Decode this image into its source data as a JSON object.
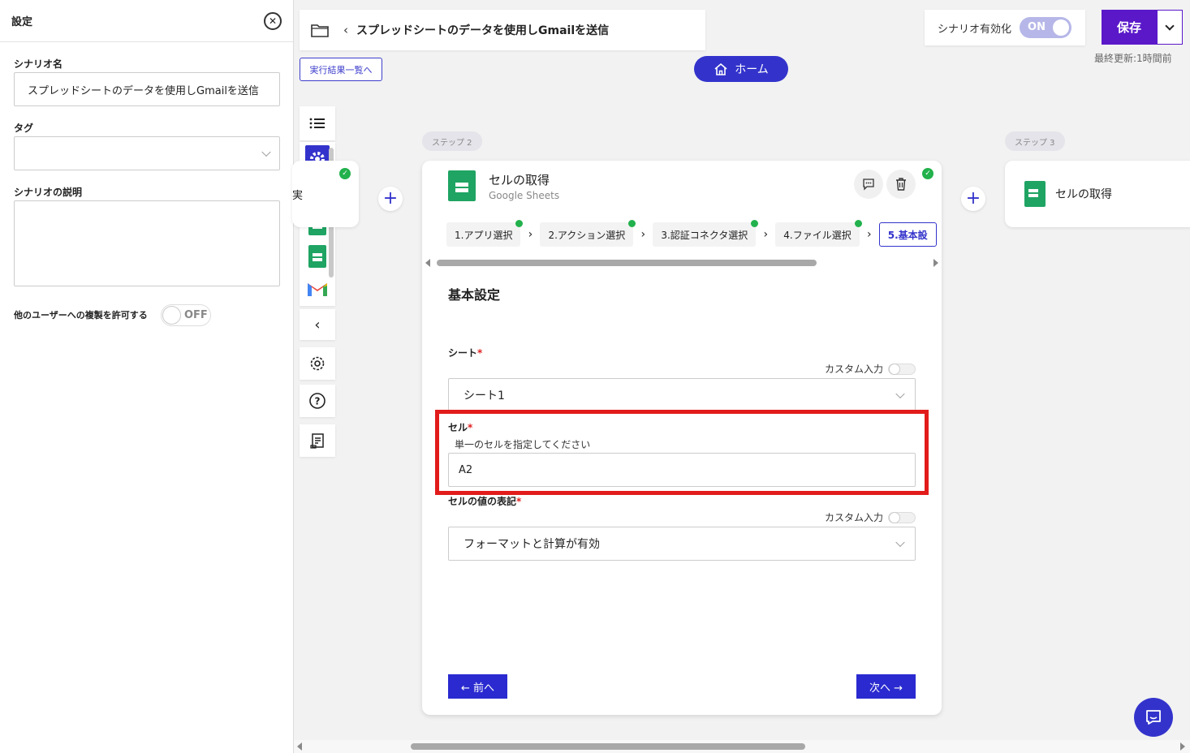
{
  "settings": {
    "title": "設定",
    "scenario_name_label": "シナリオ名",
    "scenario_name_value": "スプレッドシートのデータを使用しGmailを送信",
    "tag_label": "タグ",
    "tag_value": "",
    "description_label": "シナリオの説明",
    "description_value": "",
    "copy_label": "他のユーザーへの複製を許可する",
    "copy_toggle": "OFF"
  },
  "header": {
    "scenario_title": "スプレッドシートのデータを使用しGmailを送信",
    "results_button": "実行結果一覧へ",
    "home_button": "ホーム",
    "enable_label": "シナリオ有効化",
    "enable_toggle": "ON",
    "save_button": "保存",
    "last_updated": "最終更新:1時間前"
  },
  "canvas": {
    "prev_card_partial_text": "実",
    "step2_label": "ステップ 2",
    "step3_label": "ステップ 3",
    "step3_title": "セルの取得"
  },
  "card": {
    "title": "セルの取得",
    "subtitle": "Google Sheets",
    "tabs": [
      {
        "label": "1.アプリ選択",
        "done": true
      },
      {
        "label": "2.アクション選択",
        "done": true
      },
      {
        "label": "3.認証コネクタ選択",
        "done": true
      },
      {
        "label": "4.ファイル選択",
        "done": true
      },
      {
        "label": "5.基本設",
        "done": false,
        "active": true
      }
    ],
    "section_title": "基本設定",
    "sheet_label": "シート",
    "custom_input_label": "カスタム入力",
    "sheet_value": "シート1",
    "cell_label": "セル",
    "cell_hint": "単一のセルを指定してください",
    "cell_value": "A2",
    "format_label": "セルの値の表記",
    "format_value": "フォーマットと計算が有効",
    "required_mark": "*",
    "prev_button": "← 前へ",
    "next_button": "次へ →"
  },
  "colors": {
    "accent": "#3333cc",
    "save": "#5a18c9",
    "highlight": "#e21b1b",
    "success": "#22b14c",
    "sheets_green": "#1fa463"
  }
}
